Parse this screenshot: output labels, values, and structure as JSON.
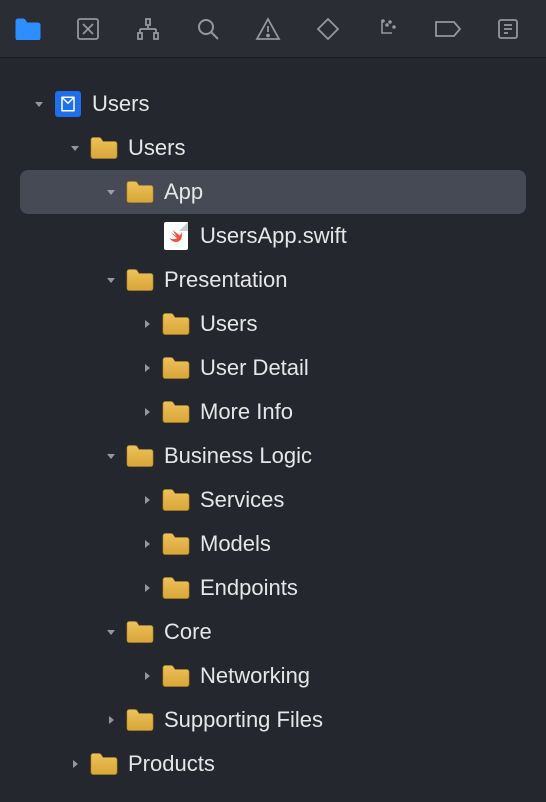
{
  "toolbar": [
    {
      "name": "project-navigator-icon",
      "active": true
    },
    {
      "name": "source-control-navigator-icon",
      "active": false
    },
    {
      "name": "symbol-navigator-icon",
      "active": false
    },
    {
      "name": "find-navigator-icon",
      "active": false
    },
    {
      "name": "issue-navigator-icon",
      "active": false
    },
    {
      "name": "test-navigator-icon",
      "active": false
    },
    {
      "name": "debug-navigator-icon",
      "active": false
    },
    {
      "name": "breakpoint-navigator-icon",
      "active": false
    },
    {
      "name": "report-navigator-icon",
      "active": false
    }
  ],
  "tree": [
    {
      "depth": 0,
      "disclosure": "open",
      "icon": "project",
      "label": "Users",
      "selected": false,
      "name": "project-root"
    },
    {
      "depth": 1,
      "disclosure": "open",
      "icon": "folder",
      "label": "Users",
      "selected": false,
      "name": "folder-users"
    },
    {
      "depth": 2,
      "disclosure": "open",
      "icon": "folder",
      "label": "App",
      "selected": true,
      "name": "folder-app"
    },
    {
      "depth": 3,
      "disclosure": "none",
      "icon": "swift",
      "label": "UsersApp.swift",
      "selected": false,
      "name": "file-usersapp-swift"
    },
    {
      "depth": 2,
      "disclosure": "open",
      "icon": "folder",
      "label": "Presentation",
      "selected": false,
      "name": "folder-presentation"
    },
    {
      "depth": 3,
      "disclosure": "closed",
      "icon": "folder",
      "label": "Users",
      "selected": false,
      "name": "folder-presentation-users"
    },
    {
      "depth": 3,
      "disclosure": "closed",
      "icon": "folder",
      "label": "User Detail",
      "selected": false,
      "name": "folder-user-detail"
    },
    {
      "depth": 3,
      "disclosure": "closed",
      "icon": "folder",
      "label": "More Info",
      "selected": false,
      "name": "folder-more-info"
    },
    {
      "depth": 2,
      "disclosure": "open",
      "icon": "folder",
      "label": "Business Logic",
      "selected": false,
      "name": "folder-business-logic"
    },
    {
      "depth": 3,
      "disclosure": "closed",
      "icon": "folder",
      "label": "Services",
      "selected": false,
      "name": "folder-services"
    },
    {
      "depth": 3,
      "disclosure": "closed",
      "icon": "folder",
      "label": "Models",
      "selected": false,
      "name": "folder-models"
    },
    {
      "depth": 3,
      "disclosure": "closed",
      "icon": "folder",
      "label": "Endpoints",
      "selected": false,
      "name": "folder-endpoints"
    },
    {
      "depth": 2,
      "disclosure": "open",
      "icon": "folder",
      "label": "Core",
      "selected": false,
      "name": "folder-core"
    },
    {
      "depth": 3,
      "disclosure": "closed",
      "icon": "folder",
      "label": "Networking",
      "selected": false,
      "name": "folder-networking"
    },
    {
      "depth": 2,
      "disclosure": "closed",
      "icon": "folder",
      "label": "Supporting Files",
      "selected": false,
      "name": "folder-supporting-files"
    },
    {
      "depth": 1,
      "disclosure": "closed",
      "icon": "folder",
      "label": "Products",
      "selected": false,
      "name": "folder-products"
    }
  ],
  "colors": {
    "folder": "#e1b84e",
    "folderShadow": "#c99a2a",
    "accent": "#2e8eff"
  }
}
